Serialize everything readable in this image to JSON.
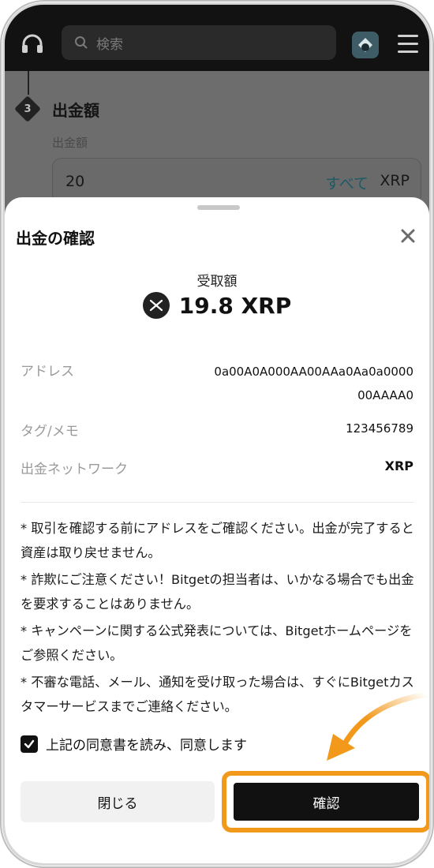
{
  "topbar": {
    "search_placeholder": "検索",
    "icons": {
      "support": "headset-icon",
      "search": "search-icon",
      "avatar": "avatar-icon",
      "menu": "hamburger-menu-icon"
    }
  },
  "withdraw_form": {
    "step_number": "3",
    "step_title": "出金額",
    "amount_label": "出金額",
    "amount_value": "20",
    "all_label": "すべて",
    "unit": "XRP"
  },
  "sheet": {
    "title": "出金の確認",
    "receive_label": "受取額",
    "receive_amount": "19.8 XRP",
    "coin_icon": "xrp-coin-icon",
    "rows": {
      "address_label": "アドレス",
      "address_value": "0a00A0A000AA00AAa0Aa0a000000AAAA0",
      "tag_label": "タグ/メモ",
      "tag_value": "123456789",
      "network_label": "出金ネットワーク",
      "network_value": "XRP"
    },
    "notes": [
      "* 取引を確認する前にアドレスをご確認ください。出金が完了すると資産は取り戻せません。",
      "* 詐欺にご注意ください！Bitgetの担当者は、いかなる場合でも出金を要求することはありません。",
      "* キャンペーンに関する公式発表については、Bitgetホームページをご参照ください。",
      "* 不審な電話、メール、通知を受け取った場合は、すぐにBitgetカスタマーサービスまでご連絡ください。"
    ],
    "agree_text": "上記の同意書を読み、同意します",
    "agree_checked": true,
    "close_button": "閉じる",
    "confirm_button": "確認"
  },
  "colors": {
    "highlight": "#f2991c",
    "primary_button": "#111111",
    "accent_link": "#1d5a66"
  }
}
